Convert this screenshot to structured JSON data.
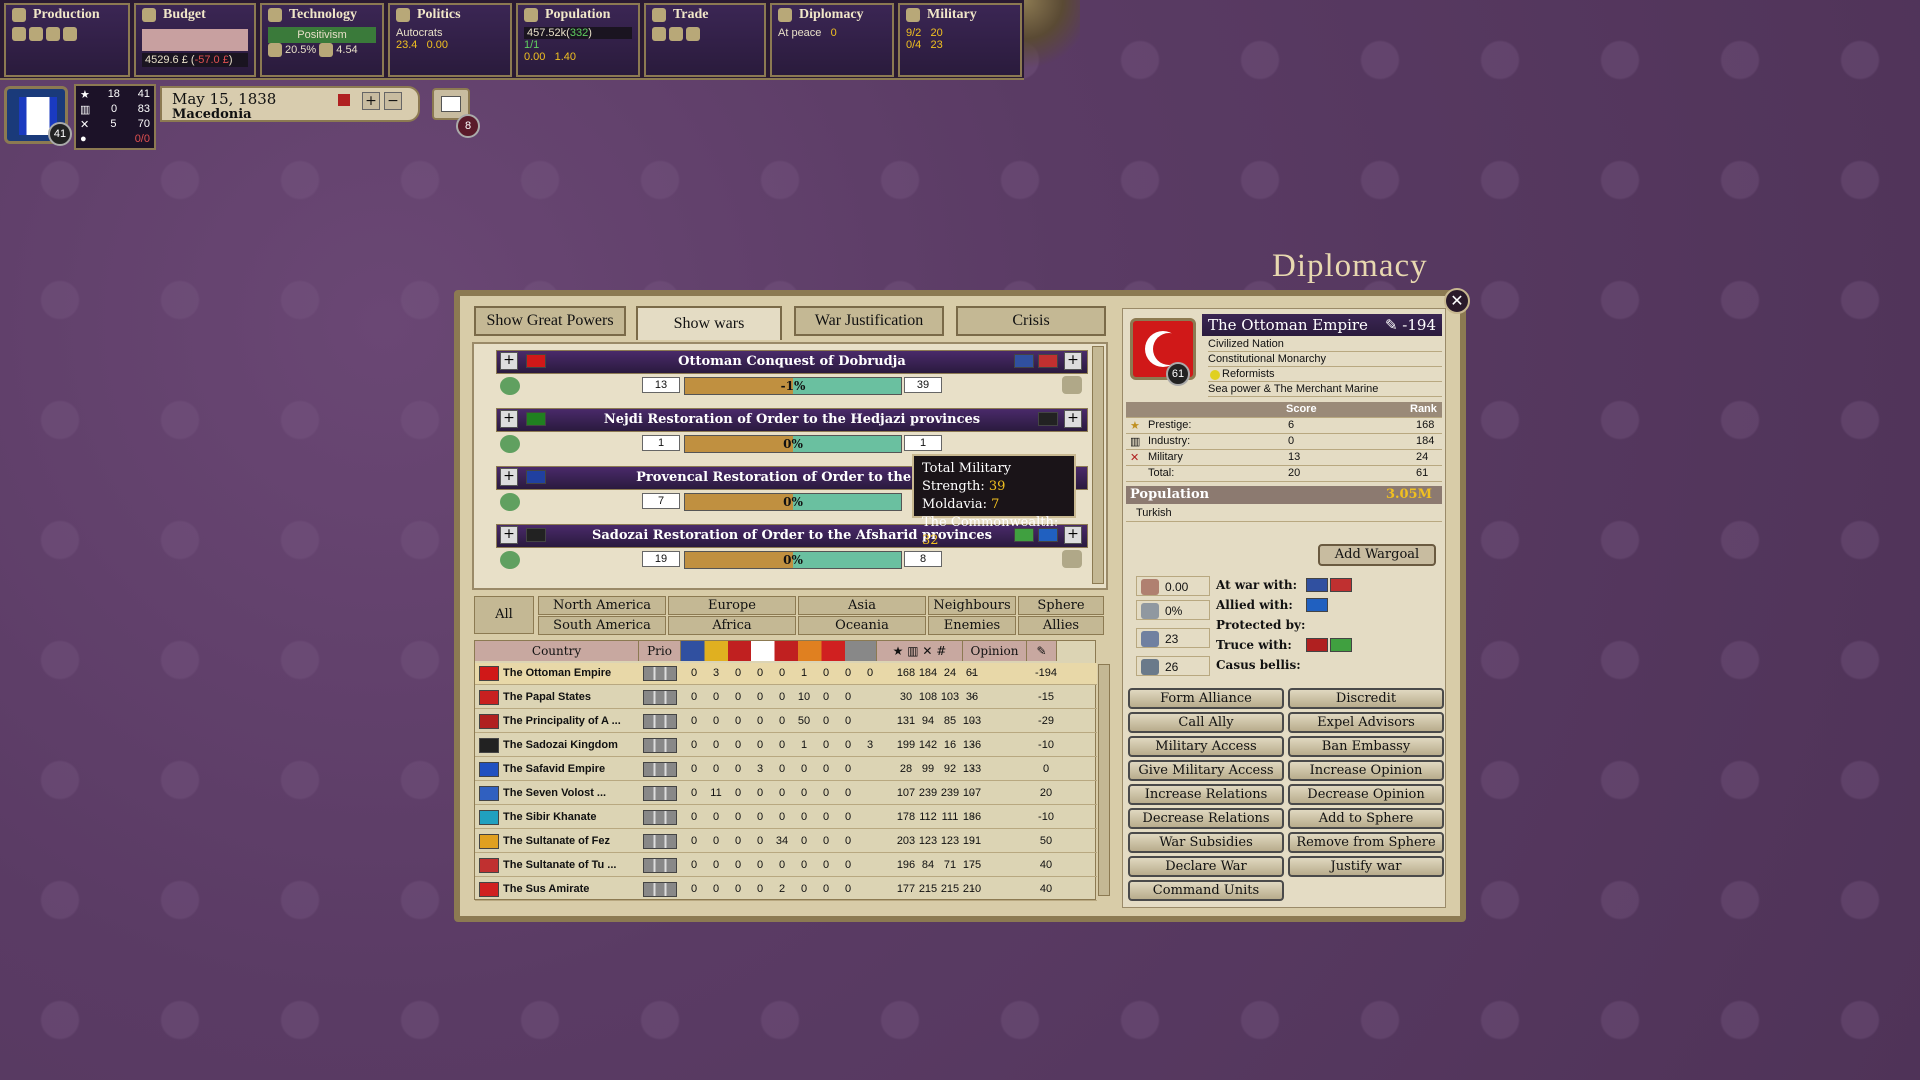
{
  "topbar": {
    "production": {
      "label": "Production"
    },
    "budget": {
      "label": "Budget",
      "value": "4529.6 £",
      "delta": "-57.0 £"
    },
    "technology": {
      "label": "Technology",
      "current": "Positivism",
      "research_pct": "20.5%",
      "literacy": "4.54"
    },
    "politics": {
      "label": "Politics",
      "party": "Autocrats",
      "value1": "23.4",
      "value2": "0.00"
    },
    "population": {
      "label": "Population",
      "total": "457.52k",
      "change": "332",
      "v1": "1/1",
      "v2": "0.00",
      "v3": "1.40"
    },
    "trade": {
      "label": "Trade"
    },
    "diplomacy": {
      "label": "Diplomacy",
      "status": "At peace",
      "count": "0"
    },
    "military": {
      "label": "Military",
      "v1": "9/2",
      "v2": "20",
      "v3": "0/4",
      "v4": "23"
    }
  },
  "player": {
    "rank": "41",
    "stats": [
      [
        "18",
        "41"
      ],
      [
        "0",
        "83"
      ],
      [
        "5",
        "70"
      ],
      [
        "",
        "0/0"
      ]
    ],
    "date": "May 15, 1838",
    "province": "Macedonia",
    "messages": "8"
  },
  "window": {
    "title": "Diplomacy",
    "tabs": [
      "Show Great Powers",
      "Show wars",
      "War Justification",
      "Crisis"
    ],
    "active_tab": "Show wars"
  },
  "wars": [
    {
      "name": "Ottoman Conquest of Dobrudja",
      "att": "13",
      "pct": "-1%",
      "def": "39"
    },
    {
      "name": "Nejdi Restoration of Order to the Hedjazi provinces",
      "att": "1",
      "pct": "0%",
      "def": "1"
    },
    {
      "name": "Provencal Restoration of Order to the Etru",
      "att": "7",
      "pct": "0%",
      "def": ""
    },
    {
      "name": "Sadozai Restoration of Order to the Afsharid provinces",
      "att": "19",
      "pct": "0%",
      "def": "8"
    }
  ],
  "tooltip": {
    "line1": "Total Military Strength:",
    "v1": "39",
    "line2": "Moldavia:",
    "v2": "7",
    "line3": "The Commonwealth:",
    "v3": "32"
  },
  "filters": {
    "all": "All",
    "regions": [
      "North America",
      "Europe",
      "Asia",
      "Neighbours",
      "Sphere",
      "South America",
      "Africa",
      "Oceania",
      "Enemies",
      "Allies"
    ]
  },
  "table": {
    "headers": [
      "Country",
      "Prio",
      "Opinion"
    ],
    "rows": [
      {
        "name": "The Ottoman Empire",
        "c": [
          "0",
          "3",
          "0",
          "0",
          "0",
          "1",
          "0",
          "0",
          "0"
        ],
        "r": [
          "168",
          "184",
          "24",
          "61"
        ],
        "op": "-",
        "rel": "-194",
        "color": "#d01818"
      },
      {
        "name": "The Papal States",
        "c": [
          "0",
          "0",
          "0",
          "0",
          "0",
          "10",
          "0",
          "0",
          ""
        ],
        "r": [
          "30",
          "108",
          "103",
          "36"
        ],
        "op": "-",
        "rel": "-15",
        "color": "#c82020"
      },
      {
        "name": "The Principality of A ...",
        "c": [
          "0",
          "0",
          "0",
          "0",
          "0",
          "50",
          "0",
          "0",
          ""
        ],
        "r": [
          "131",
          "94",
          "85",
          "103"
        ],
        "op": "-",
        "rel": "-29",
        "color": "#b02020"
      },
      {
        "name": "The Sadozai Kingdom",
        "c": [
          "0",
          "0",
          "0",
          "0",
          "0",
          "1",
          "0",
          "0",
          "3"
        ],
        "r": [
          "199",
          "142",
          "16",
          "136"
        ],
        "op": "-",
        "rel": "-10",
        "color": "#222222"
      },
      {
        "name": "The Safavid Empire",
        "c": [
          "0",
          "0",
          "0",
          "3",
          "0",
          "0",
          "0",
          "0",
          ""
        ],
        "r": [
          "28",
          "99",
          "92",
          "133"
        ],
        "op": "-",
        "rel": "0",
        "color": "#2050c0"
      },
      {
        "name": "The Seven Volost ...",
        "c": [
          "0",
          "11",
          "0",
          "0",
          "0",
          "0",
          "0",
          "0",
          ""
        ],
        "r": [
          "107",
          "239",
          "239",
          "107"
        ],
        "op": "-",
        "rel": "20",
        "color": "#3060c0"
      },
      {
        "name": "The Sibir Khanate",
        "c": [
          "0",
          "0",
          "0",
          "0",
          "0",
          "0",
          "0",
          "0",
          ""
        ],
        "r": [
          "178",
          "112",
          "111",
          "186"
        ],
        "op": "-",
        "rel": "-10",
        "color": "#20a0c0"
      },
      {
        "name": "The Sultanate of Fez",
        "c": [
          "0",
          "0",
          "0",
          "0",
          "34",
          "0",
          "0",
          "0",
          ""
        ],
        "r": [
          "203",
          "123",
          "123",
          "191"
        ],
        "op": "-",
        "rel": "50",
        "color": "#e0a020"
      },
      {
        "name": "The Sultanate of Tu ...",
        "c": [
          "0",
          "0",
          "0",
          "0",
          "0",
          "0",
          "0",
          "0",
          ""
        ],
        "r": [
          "196",
          "84",
          "71",
          "175"
        ],
        "op": "-",
        "rel": "40",
        "color": "#c03030"
      },
      {
        "name": "The Sus Amirate",
        "c": [
          "0",
          "0",
          "0",
          "0",
          "2",
          "0",
          "0",
          "0",
          ""
        ],
        "r": [
          "177",
          "215",
          "215",
          "210"
        ],
        "op": "-",
        "rel": "40",
        "color": "#d02020"
      }
    ]
  },
  "country": {
    "name": "The Ottoman Empire",
    "relation": "-194",
    "rank_badge": "61",
    "lines": [
      "Civilized Nation",
      "Constitutional Monarchy",
      "Reformists",
      "Sea power & The Merchant Marine"
    ],
    "score_header": "Score",
    "rank_header": "Rank",
    "ranks": [
      {
        "label": "Prestige:",
        "score": "6",
        "rank": "168"
      },
      {
        "label": "Industry:",
        "score": "0",
        "rank": "184"
      },
      {
        "label": "Military",
        "score": "13",
        "rank": "24"
      },
      {
        "label": "Total:",
        "score": "20",
        "rank": "61"
      }
    ],
    "population_label": "Population",
    "population_value": "3.05M",
    "culture": "Turkish",
    "add_wargoal": "Add Wargoal",
    "left_vals": [
      "0.00",
      "0%",
      "23",
      "26"
    ],
    "rel_labels": [
      "At war with:",
      "Allied with:",
      "Protected by:",
      "Truce with:",
      "Casus bellis:"
    ]
  },
  "actions": [
    [
      "Form Alliance",
      "Discredit"
    ],
    [
      "Call Ally",
      "Expel Advisors"
    ],
    [
      "Military Access",
      "Ban Embassy"
    ],
    [
      "Give Military Access",
      "Increase Opinion"
    ],
    [
      "Increase Relations",
      "Decrease Opinion"
    ],
    [
      "Decrease Relations",
      "Add to Sphere"
    ],
    [
      "War Subsidies",
      "Remove from Sphere"
    ],
    [
      "Declare War",
      "Justify war"
    ],
    [
      "Command Units",
      ""
    ]
  ]
}
